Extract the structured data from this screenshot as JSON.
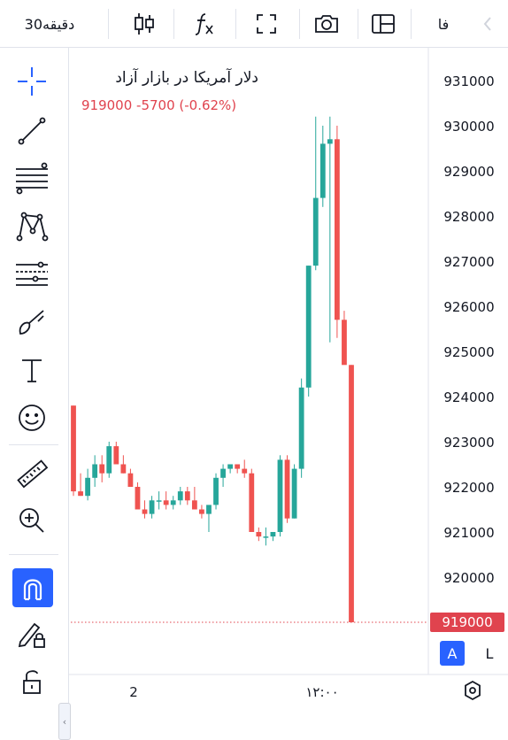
{
  "topbar": {
    "interval_label": "30دقیقه",
    "lang_label": "فا"
  },
  "chart_header": {
    "title": "دلار آمریکا در بازار آزاد",
    "change_line": "919000 -5700 (-0.62%)"
  },
  "colors": {
    "up": "#26a69a",
    "down": "#ef5350",
    "accent": "#2962ff",
    "last_price_bg": "#e0434e"
  },
  "toolbar_icons": [
    "candles-icon",
    "fx-icon",
    "fullscreen-icon",
    "camera-icon",
    "layout-icon"
  ],
  "sidebar_tools": [
    "crosshair-icon",
    "trendline-icon",
    "fib-icon",
    "pattern-icon",
    "gann-icon",
    "brush-icon",
    "text-icon",
    "emoji-icon",
    "ruler-icon",
    "zoom-in-icon",
    "magnet-icon",
    "lock-draw-icon",
    "lock-icon"
  ],
  "last_price_label": "919000",
  "scale_buttons": {
    "auto": "A",
    "log": "L"
  },
  "chart_data": {
    "type": "candlestick",
    "title": "دلار آمریکا در بازار آزاد",
    "y_ticks": [
      "931000",
      "930000",
      "929000",
      "928000",
      "927000",
      "926000",
      "925000",
      "924000",
      "923000",
      "922000",
      "921000",
      "920000",
      "919000"
    ],
    "ylim": [
      918700,
      931300
    ],
    "x_labels": [
      "2",
      "۱۲:۰۰"
    ],
    "last_price": 919000,
    "candles": [
      {
        "o": 923800,
        "h": 923800,
        "l": 921800,
        "c": 921900
      },
      {
        "o": 921900,
        "h": 922300,
        "l": 921800,
        "c": 921800
      },
      {
        "o": 921800,
        "h": 922400,
        "l": 921700,
        "c": 922200
      },
      {
        "o": 922200,
        "h": 922700,
        "l": 922000,
        "c": 922500
      },
      {
        "o": 922500,
        "h": 922700,
        "l": 922100,
        "c": 922300
      },
      {
        "o": 922300,
        "h": 923000,
        "l": 922200,
        "c": 922900
      },
      {
        "o": 922900,
        "h": 923000,
        "l": 922500,
        "c": 922500
      },
      {
        "o": 922500,
        "h": 922700,
        "l": 922300,
        "c": 922300
      },
      {
        "o": 922300,
        "h": 922400,
        "l": 922000,
        "c": 922000
      },
      {
        "o": 922000,
        "h": 922100,
        "l": 921500,
        "c": 921500
      },
      {
        "o": 921500,
        "h": 921700,
        "l": 921300,
        "c": 921400
      },
      {
        "o": 921400,
        "h": 921800,
        "l": 921300,
        "c": 921700
      },
      {
        "o": 921700,
        "h": 921900,
        "l": 921500,
        "c": 921700
      },
      {
        "o": 921700,
        "h": 921900,
        "l": 921500,
        "c": 921600
      },
      {
        "o": 921600,
        "h": 921800,
        "l": 921500,
        "c": 921700
      },
      {
        "o": 921700,
        "h": 922000,
        "l": 921600,
        "c": 921900
      },
      {
        "o": 921900,
        "h": 922000,
        "l": 921600,
        "c": 921700
      },
      {
        "o": 921700,
        "h": 922000,
        "l": 921600,
        "c": 921500
      },
      {
        "o": 921500,
        "h": 921600,
        "l": 921300,
        "c": 921400
      },
      {
        "o": 921400,
        "h": 921500,
        "l": 921000,
        "c": 921600
      },
      {
        "o": 921600,
        "h": 922300,
        "l": 921500,
        "c": 922200
      },
      {
        "o": 922200,
        "h": 922500,
        "l": 922000,
        "c": 922400
      },
      {
        "o": 922400,
        "h": 922500,
        "l": 922300,
        "c": 922500
      },
      {
        "o": 922500,
        "h": 922500,
        "l": 922300,
        "c": 922400
      },
      {
        "o": 922400,
        "h": 922600,
        "l": 922200,
        "c": 922300
      },
      {
        "o": 922300,
        "h": 922400,
        "l": 921000,
        "c": 921000
      },
      {
        "o": 921000,
        "h": 921100,
        "l": 920800,
        "c": 920900
      },
      {
        "o": 920900,
        "h": 921100,
        "l": 920700,
        "c": 920900
      },
      {
        "o": 920900,
        "h": 921000,
        "l": 920800,
        "c": 921000
      },
      {
        "o": 921000,
        "h": 922700,
        "l": 920900,
        "c": 922600
      },
      {
        "o": 922600,
        "h": 922700,
        "l": 921200,
        "c": 921300
      },
      {
        "o": 921300,
        "h": 922500,
        "l": 921300,
        "c": 922400
      },
      {
        "o": 922400,
        "h": 924400,
        "l": 922200,
        "c": 924200
      },
      {
        "o": 924200,
        "h": 926900,
        "l": 924000,
        "c": 926900
      },
      {
        "o": 926900,
        "h": 930200,
        "l": 926800,
        "c": 928400
      },
      {
        "o": 928400,
        "h": 930000,
        "l": 928200,
        "c": 929600
      },
      {
        "o": 929600,
        "h": 930200,
        "l": 925200,
        "c": 929700
      },
      {
        "o": 929700,
        "h": 930000,
        "l": 925300,
        "c": 925700
      },
      {
        "o": 925700,
        "h": 925900,
        "l": 924800,
        "c": 924700
      },
      {
        "o": 924700,
        "h": 924700,
        "l": 919000,
        "c": 919000
      }
    ]
  }
}
